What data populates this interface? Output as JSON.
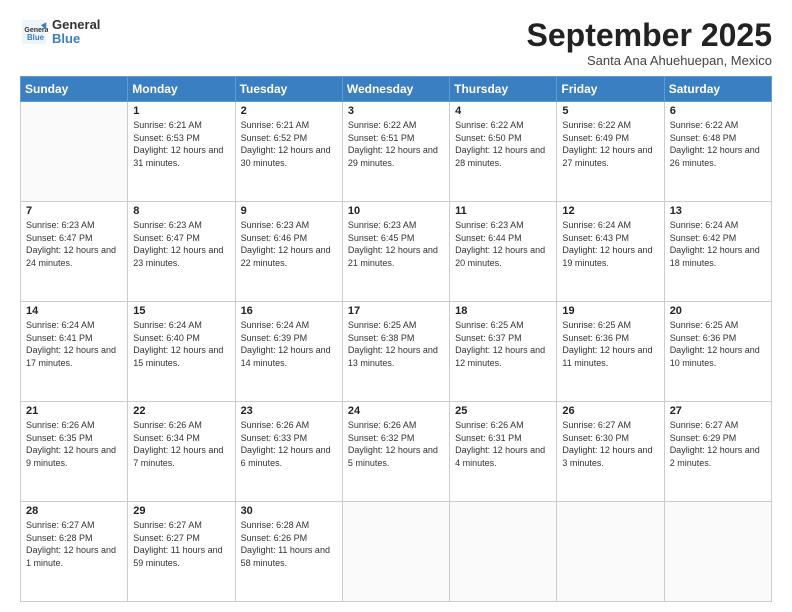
{
  "header": {
    "logo": {
      "general": "General",
      "blue": "Blue"
    },
    "title": "September 2025",
    "location": "Santa Ana Ahuehuepan, Mexico"
  },
  "weekdays": [
    "Sunday",
    "Monday",
    "Tuesday",
    "Wednesday",
    "Thursday",
    "Friday",
    "Saturday"
  ],
  "weeks": [
    [
      {
        "day": "",
        "sunrise": "",
        "sunset": "",
        "daylight": ""
      },
      {
        "day": "1",
        "sunrise": "Sunrise: 6:21 AM",
        "sunset": "Sunset: 6:53 PM",
        "daylight": "Daylight: 12 hours and 31 minutes."
      },
      {
        "day": "2",
        "sunrise": "Sunrise: 6:21 AM",
        "sunset": "Sunset: 6:52 PM",
        "daylight": "Daylight: 12 hours and 30 minutes."
      },
      {
        "day": "3",
        "sunrise": "Sunrise: 6:22 AM",
        "sunset": "Sunset: 6:51 PM",
        "daylight": "Daylight: 12 hours and 29 minutes."
      },
      {
        "day": "4",
        "sunrise": "Sunrise: 6:22 AM",
        "sunset": "Sunset: 6:50 PM",
        "daylight": "Daylight: 12 hours and 28 minutes."
      },
      {
        "day": "5",
        "sunrise": "Sunrise: 6:22 AM",
        "sunset": "Sunset: 6:49 PM",
        "daylight": "Daylight: 12 hours and 27 minutes."
      },
      {
        "day": "6",
        "sunrise": "Sunrise: 6:22 AM",
        "sunset": "Sunset: 6:48 PM",
        "daylight": "Daylight: 12 hours and 26 minutes."
      }
    ],
    [
      {
        "day": "7",
        "sunrise": "Sunrise: 6:23 AM",
        "sunset": "Sunset: 6:47 PM",
        "daylight": "Daylight: 12 hours and 24 minutes."
      },
      {
        "day": "8",
        "sunrise": "Sunrise: 6:23 AM",
        "sunset": "Sunset: 6:47 PM",
        "daylight": "Daylight: 12 hours and 23 minutes."
      },
      {
        "day": "9",
        "sunrise": "Sunrise: 6:23 AM",
        "sunset": "Sunset: 6:46 PM",
        "daylight": "Daylight: 12 hours and 22 minutes."
      },
      {
        "day": "10",
        "sunrise": "Sunrise: 6:23 AM",
        "sunset": "Sunset: 6:45 PM",
        "daylight": "Daylight: 12 hours and 21 minutes."
      },
      {
        "day": "11",
        "sunrise": "Sunrise: 6:23 AM",
        "sunset": "Sunset: 6:44 PM",
        "daylight": "Daylight: 12 hours and 20 minutes."
      },
      {
        "day": "12",
        "sunrise": "Sunrise: 6:24 AM",
        "sunset": "Sunset: 6:43 PM",
        "daylight": "Daylight: 12 hours and 19 minutes."
      },
      {
        "day": "13",
        "sunrise": "Sunrise: 6:24 AM",
        "sunset": "Sunset: 6:42 PM",
        "daylight": "Daylight: 12 hours and 18 minutes."
      }
    ],
    [
      {
        "day": "14",
        "sunrise": "Sunrise: 6:24 AM",
        "sunset": "Sunset: 6:41 PM",
        "daylight": "Daylight: 12 hours and 17 minutes."
      },
      {
        "day": "15",
        "sunrise": "Sunrise: 6:24 AM",
        "sunset": "Sunset: 6:40 PM",
        "daylight": "Daylight: 12 hours and 15 minutes."
      },
      {
        "day": "16",
        "sunrise": "Sunrise: 6:24 AM",
        "sunset": "Sunset: 6:39 PM",
        "daylight": "Daylight: 12 hours and 14 minutes."
      },
      {
        "day": "17",
        "sunrise": "Sunrise: 6:25 AM",
        "sunset": "Sunset: 6:38 PM",
        "daylight": "Daylight: 12 hours and 13 minutes."
      },
      {
        "day": "18",
        "sunrise": "Sunrise: 6:25 AM",
        "sunset": "Sunset: 6:37 PM",
        "daylight": "Daylight: 12 hours and 12 minutes."
      },
      {
        "day": "19",
        "sunrise": "Sunrise: 6:25 AM",
        "sunset": "Sunset: 6:36 PM",
        "daylight": "Daylight: 12 hours and 11 minutes."
      },
      {
        "day": "20",
        "sunrise": "Sunrise: 6:25 AM",
        "sunset": "Sunset: 6:36 PM",
        "daylight": "Daylight: 12 hours and 10 minutes."
      }
    ],
    [
      {
        "day": "21",
        "sunrise": "Sunrise: 6:26 AM",
        "sunset": "Sunset: 6:35 PM",
        "daylight": "Daylight: 12 hours and 9 minutes."
      },
      {
        "day": "22",
        "sunrise": "Sunrise: 6:26 AM",
        "sunset": "Sunset: 6:34 PM",
        "daylight": "Daylight: 12 hours and 7 minutes."
      },
      {
        "day": "23",
        "sunrise": "Sunrise: 6:26 AM",
        "sunset": "Sunset: 6:33 PM",
        "daylight": "Daylight: 12 hours and 6 minutes."
      },
      {
        "day": "24",
        "sunrise": "Sunrise: 6:26 AM",
        "sunset": "Sunset: 6:32 PM",
        "daylight": "Daylight: 12 hours and 5 minutes."
      },
      {
        "day": "25",
        "sunrise": "Sunrise: 6:26 AM",
        "sunset": "Sunset: 6:31 PM",
        "daylight": "Daylight: 12 hours and 4 minutes."
      },
      {
        "day": "26",
        "sunrise": "Sunrise: 6:27 AM",
        "sunset": "Sunset: 6:30 PM",
        "daylight": "Daylight: 12 hours and 3 minutes."
      },
      {
        "day": "27",
        "sunrise": "Sunrise: 6:27 AM",
        "sunset": "Sunset: 6:29 PM",
        "daylight": "Daylight: 12 hours and 2 minutes."
      }
    ],
    [
      {
        "day": "28",
        "sunrise": "Sunrise: 6:27 AM",
        "sunset": "Sunset: 6:28 PM",
        "daylight": "Daylight: 12 hours and 1 minute."
      },
      {
        "day": "29",
        "sunrise": "Sunrise: 6:27 AM",
        "sunset": "Sunset: 6:27 PM",
        "daylight": "Daylight: 11 hours and 59 minutes."
      },
      {
        "day": "30",
        "sunrise": "Sunrise: 6:28 AM",
        "sunset": "Sunset: 6:26 PM",
        "daylight": "Daylight: 11 hours and 58 minutes."
      },
      {
        "day": "",
        "sunrise": "",
        "sunset": "",
        "daylight": ""
      },
      {
        "day": "",
        "sunrise": "",
        "sunset": "",
        "daylight": ""
      },
      {
        "day": "",
        "sunrise": "",
        "sunset": "",
        "daylight": ""
      },
      {
        "day": "",
        "sunrise": "",
        "sunset": "",
        "daylight": ""
      }
    ]
  ]
}
